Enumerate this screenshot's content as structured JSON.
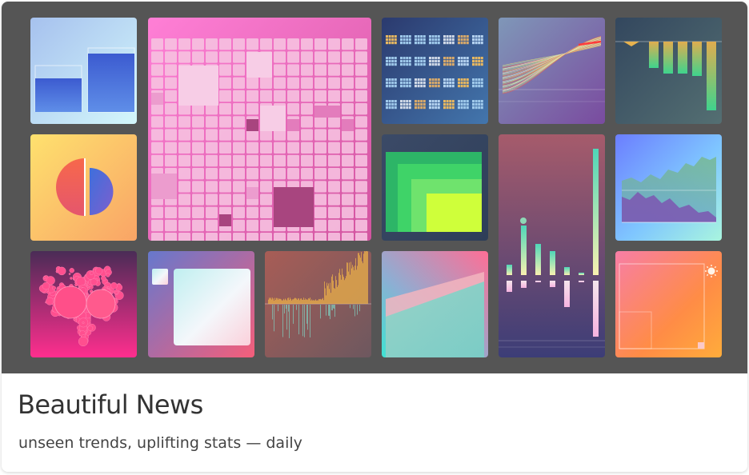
{
  "card": {
    "title": "Beautiful News",
    "subtitle": "unseen trends, uplifting stats — daily"
  },
  "hero": {
    "background": "#555555",
    "tiles": [
      {
        "name": "bar-comparison-tile",
        "colors": [
          "#a6c1ee",
          "#c2f0fc"
        ]
      },
      {
        "name": "pink-grid-tile",
        "colors": [
          "#ff7bd2",
          "#d35aa8"
        ]
      },
      {
        "name": "waffle-rows-tile",
        "colors": [
          "#2c3e73",
          "#3f6ea6"
        ]
      },
      {
        "name": "flowing-lines-tile",
        "colors": [
          "#7e94b5",
          "#7d4fa0"
        ]
      },
      {
        "name": "descending-bars-tile",
        "colors": [
          "#34495e",
          "#4d6a70"
        ]
      },
      {
        "name": "half-circles-tile",
        "colors": [
          "#fddb6d",
          "#f9a866"
        ]
      },
      {
        "name": "nested-squares-tile",
        "colors": [
          "#3a4864",
          "#2f3f5a"
        ]
      },
      {
        "name": "diverging-bars-tile",
        "colors": [
          "#a1596a",
          "#3f3e75"
        ]
      },
      {
        "name": "area-chart-tile",
        "colors": [
          "#6a80ff",
          "#a6f3e1"
        ]
      },
      {
        "name": "bubble-heart-tile",
        "colors": [
          "#4c2d57",
          "#ff2f8d"
        ]
      },
      {
        "name": "gradient-square-tile",
        "colors": [
          "#6a75c9",
          "#f25d7d"
        ]
      },
      {
        "name": "spiky-timeseries-tile",
        "colors": [
          "#a45d58",
          "#74585c"
        ]
      },
      {
        "name": "slope-area-tile",
        "colors": [
          "#ff7a9a",
          "#45e0d1"
        ]
      },
      {
        "name": "sun-frame-tile",
        "colors": [
          "#fa7ea0",
          "#ffa73a"
        ]
      }
    ]
  }
}
